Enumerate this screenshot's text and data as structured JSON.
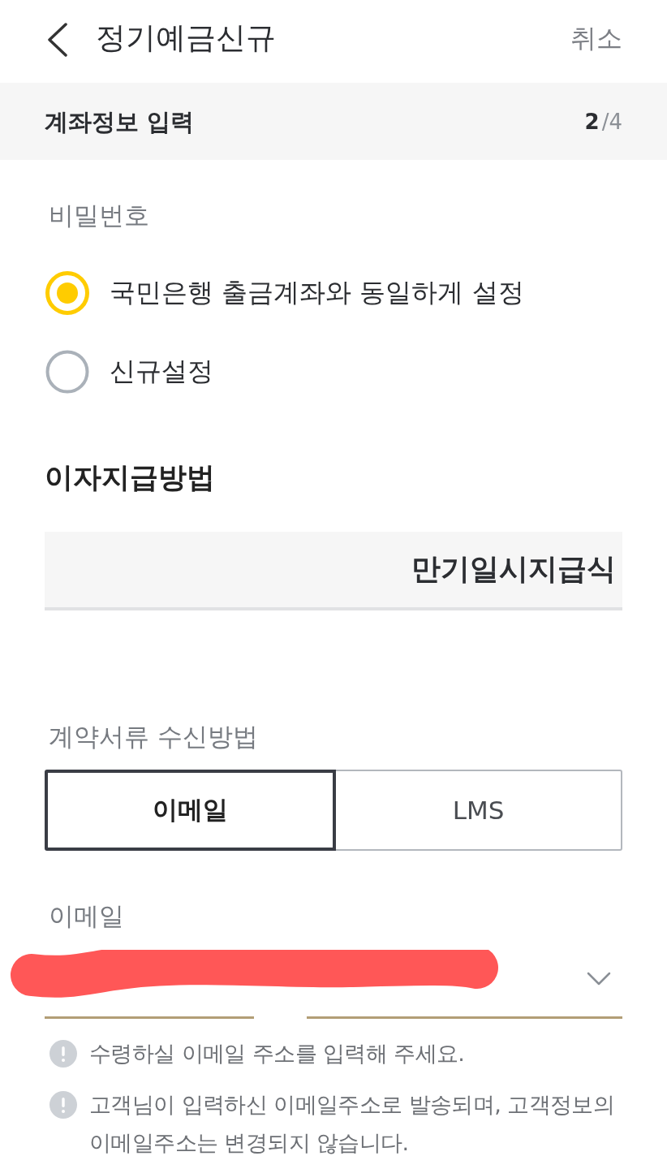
{
  "header": {
    "title": "정기예금신규",
    "cancel": "취소"
  },
  "step_bar": {
    "title": "계좌정보 입력",
    "progress": "**2**/4"
  },
  "password": {
    "label": "비밀번호",
    "options": [
      {
        "label": "국민은행 출금계좌와 동일하게 설정",
        "selected": true
      },
      {
        "label": "신규설정",
        "selected": false
      }
    ]
  },
  "interest_payment": {
    "title": "이자지급방법",
    "value": "만기일시지급식"
  },
  "document_delivery": {
    "label": "계약서류 수신방법",
    "options": [
      {
        "label": "이메일",
        "selected": true
      },
      {
        "label": "LMS",
        "selected": false
      }
    ]
  },
  "email": {
    "label": "이메일",
    "redacted": true,
    "notes": [
      "수령하실 이메일 주소를 입력해 주세요.",
      "고객님이 입력하신 이메일주소로 발송되며, 고객정보의 이메일주소는 변경되지 않습니다."
    ]
  }
}
